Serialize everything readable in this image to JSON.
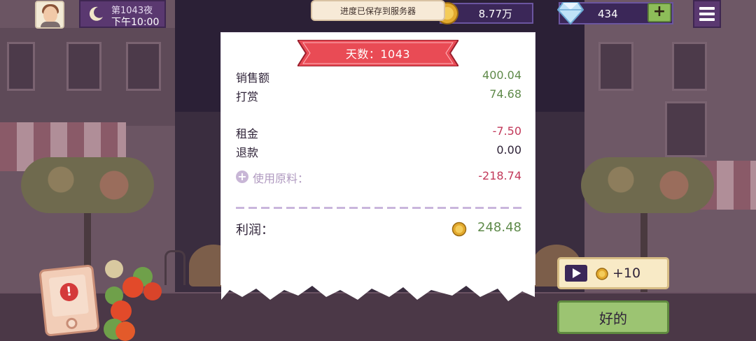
{
  "topbar": {
    "day_label": "第1043夜",
    "time_label": "下午10:00",
    "toast": "进度已保存到服务器",
    "coins": "8.77万",
    "gems": "434",
    "plus": "+"
  },
  "receipt": {
    "title": "天数：1043",
    "rows": [
      {
        "label": "销售额",
        "value": "400.04"
      },
      {
        "label": "打赏",
        "value": "74.68"
      },
      {
        "label": "租金",
        "value": "-7.50"
      },
      {
        "label": "退款",
        "value": "0.00"
      },
      {
        "label": "使用原料：",
        "value": "-218.74"
      }
    ],
    "profit_label": "利润：",
    "profit_value": "248.48"
  },
  "buttons": {
    "ad_reward": "+10",
    "ok": "好的"
  },
  "colors": {
    "positive": "#5f8a4a",
    "negative": "#c2395a",
    "ribbon": "#e94b55",
    "ok_green": "#9cc472",
    "panel_purple": "#5a3870"
  }
}
